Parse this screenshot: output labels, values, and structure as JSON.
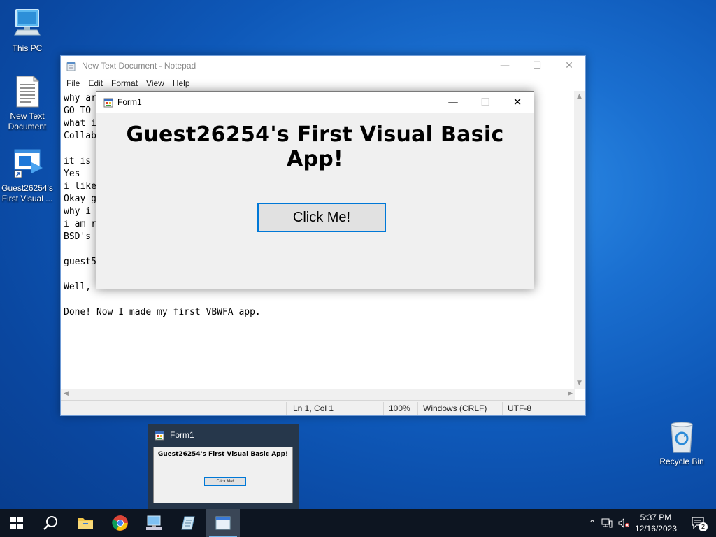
{
  "desktop": {
    "icons": [
      {
        "label": "This PC"
      },
      {
        "label": "New Text Document"
      },
      {
        "label": "Guest26254's First Visual ..."
      },
      {
        "label": "Recycle Bin"
      }
    ]
  },
  "notepad": {
    "title": "New Text Document - Notepad",
    "menu": [
      "File",
      "Edit",
      "Format",
      "View",
      "Help"
    ],
    "lines": [
      "why ar",
      "GO TO",
      "what i",
      "Collab",
      "",
      "it is",
      "Yes",
      "i like",
      "Okay g",
      "why i",
      "i am r",
      "BSD's",
      "",
      "guest5",
      "",
      "Well, ",
      "",
      "Done! Now I made my first VBWFA app."
    ],
    "status": {
      "position": "Ln 1, Col 1",
      "zoom": "100%",
      "line_ending": "Windows (CRLF)",
      "encoding": "UTF-8"
    }
  },
  "form1": {
    "title": "Form1",
    "heading": "Guest26254's First Visual Basic App!",
    "button_label": "Click Me!"
  },
  "preview": {
    "title": "Form1",
    "heading": "Guest26254's First Visual Basic App!",
    "button_label": "Click Me!"
  },
  "taskbar": {
    "time": "5:37 PM",
    "date": "12/16/2023",
    "notification_count": "2"
  },
  "colors": {
    "accent": "#0078d7",
    "taskbar": "#0d1521"
  }
}
